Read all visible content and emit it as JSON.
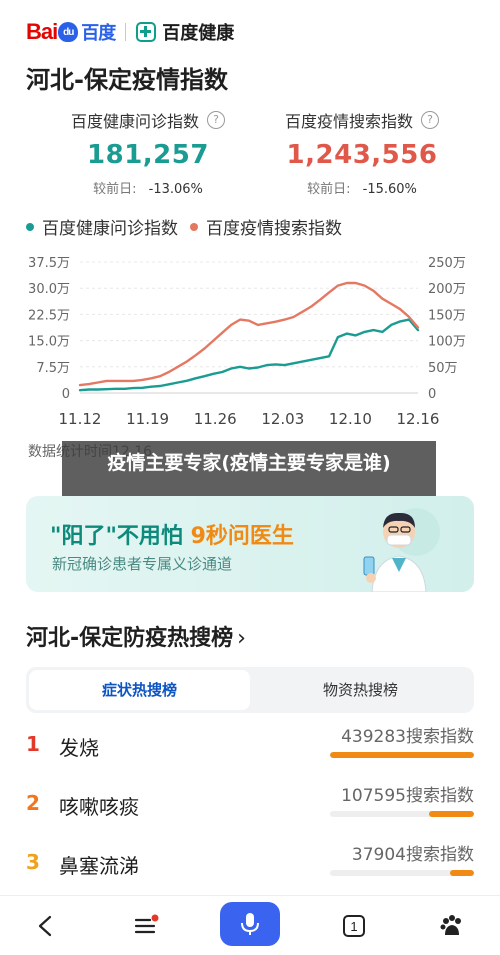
{
  "header": {
    "logo_baidu_left": "Bai",
    "logo_baidu_paw": "du",
    "logo_baidu_cn": "百度",
    "logo_health": "百度健康"
  },
  "card": {
    "title": "河北-保定疫情指数",
    "stats": [
      {
        "label": "百度健康问诊指数",
        "value": "181,257",
        "compare_label": "较前日:",
        "compare_value": "-13.06%",
        "color": "#1a9c93"
      },
      {
        "label": "百度疫情搜索指数",
        "value": "1,243,556",
        "compare_label": "较前日:",
        "compare_value": "-15.60%",
        "color": "#e0584a"
      }
    ],
    "help_glyph": "?"
  },
  "chart_data": {
    "type": "line",
    "x_labels": [
      "11.12",
      "11.19",
      "11.26",
      "12.03",
      "12.10",
      "12.16"
    ],
    "left_axis": {
      "ticks": [
        "0",
        "7.5万",
        "15.0万",
        "22.5万",
        "30.0万",
        "37.5万"
      ],
      "range": [
        0,
        37.5
      ]
    },
    "right_axis": {
      "ticks": [
        "0",
        "50万",
        "100万",
        "150万",
        "200万",
        "250万"
      ],
      "range": [
        0,
        250
      ]
    },
    "series": [
      {
        "name": "百度健康问诊指数",
        "color": "#1a9c93",
        "axis": "left",
        "values": [
          0.8,
          1.0,
          1.0,
          1.1,
          1.2,
          1.2,
          1.4,
          1.5,
          1.8,
          2.0,
          2.5,
          3.0,
          3.5,
          4.2,
          4.8,
          5.5,
          6.0,
          7.0,
          7.5,
          7.0,
          7.3,
          8.0,
          8.2,
          8.0,
          8.5,
          9.0,
          9.5,
          10.0,
          10.5,
          16.0,
          17.0,
          16.5,
          17.5,
          18.0,
          17.5,
          19.5,
          20.5,
          21.0,
          18.0
        ]
      },
      {
        "name": "百度疫情搜索指数",
        "color": "#e57862",
        "axis": "right",
        "values": [
          15,
          17,
          20,
          23,
          23,
          23,
          23,
          25,
          28,
          32,
          40,
          50,
          60,
          72,
          85,
          100,
          115,
          130,
          140,
          138,
          130,
          133,
          136,
          140,
          145,
          155,
          165,
          178,
          192,
          205,
          210,
          210,
          205,
          195,
          180,
          170,
          160,
          145,
          125
        ]
      }
    ]
  },
  "footnote": "数据统计时间12.16",
  "overlay_text": "疫情主要专家(疫情主要专家是谁)",
  "banner": {
    "title_part1": "\"阳了\"不用怕",
    "title_part2": "9秒问医生",
    "subtitle": "新冠确诊患者专属义诊通道"
  },
  "hot_list": {
    "title": "河北-保定防疫热搜榜",
    "chevron": "›",
    "tabs": [
      {
        "label": "症状热搜榜",
        "active": true
      },
      {
        "label": "物资热搜榜",
        "active": false
      }
    ],
    "items": [
      {
        "rank": "1",
        "name": "发烧",
        "value": "439283搜索指数",
        "fill": 1.0,
        "rank_color": "#e23a2a"
      },
      {
        "rank": "2",
        "name": "咳嗽咳痰",
        "value": "107595搜索指数",
        "fill": 0.31,
        "rank_color": "#f0771c"
      },
      {
        "rank": "3",
        "name": "鼻塞流涕",
        "value": "37904搜索指数",
        "fill": 0.17,
        "rank_color": "#f0a21c"
      }
    ]
  },
  "bottom_nav": {
    "tab_count": "1"
  }
}
